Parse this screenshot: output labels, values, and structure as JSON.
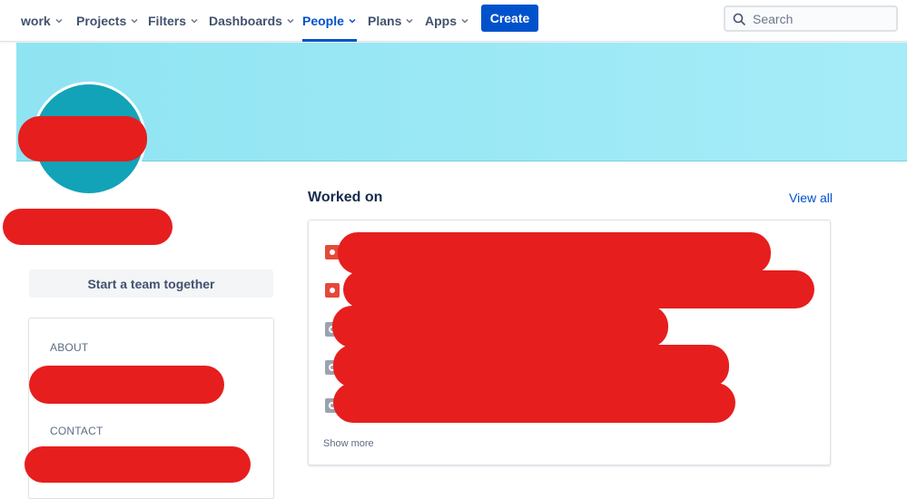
{
  "nav": {
    "items": [
      {
        "label": "work",
        "has_dropdown": true,
        "active": false
      },
      {
        "label": "Projects",
        "has_dropdown": true,
        "active": false
      },
      {
        "label": "Filters",
        "has_dropdown": true,
        "active": false
      },
      {
        "label": "Dashboards",
        "has_dropdown": true,
        "active": false
      },
      {
        "label": "People",
        "has_dropdown": true,
        "active": true
      },
      {
        "label": "Plans",
        "has_dropdown": true,
        "active": false
      },
      {
        "label": "Apps",
        "has_dropdown": true,
        "active": false
      }
    ],
    "create_label": "Create",
    "search_placeholder": "Search",
    "search_icon": "search-icon"
  },
  "colors": {
    "brand": "#0052cc",
    "header_band": "#a6ecf8",
    "avatar": "#12a3b8",
    "redaction": "#e61e1e",
    "bug": "#e5493a",
    "task": "#9ba3af"
  },
  "profile": {
    "team_button_label": "Start a team together",
    "about_label": "ABOUT",
    "contact_label": "CONTACT"
  },
  "worked_on": {
    "title": "Worked on",
    "view_all_label": "View all",
    "items": [
      {
        "icon": "bug-icon"
      },
      {
        "icon": "bug-icon"
      },
      {
        "icon": "task-icon"
      },
      {
        "icon": "task-icon"
      },
      {
        "icon": "task-icon"
      }
    ],
    "show_more_label": "Show more"
  }
}
